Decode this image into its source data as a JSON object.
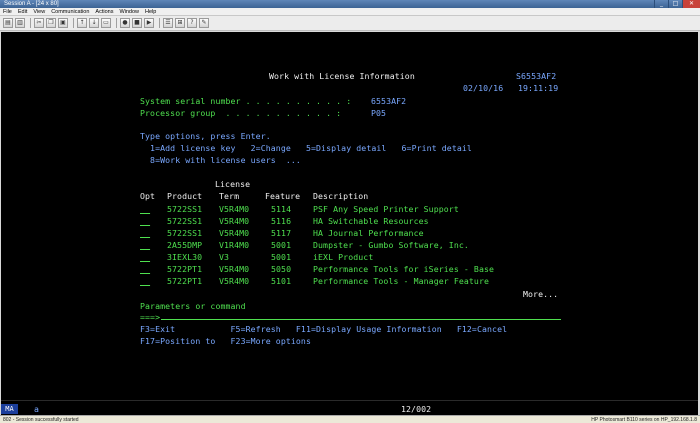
{
  "window": {
    "title": "Session A - [24 x 80]",
    "controls": [
      "_",
      "□",
      "✕"
    ]
  },
  "menu": [
    "File",
    "Edit",
    "View",
    "Communication",
    "Actions",
    "Window",
    "Help"
  ],
  "screen": {
    "heading": "Work with License Information",
    "system_id": "S6553AF2",
    "date": "02/10/16",
    "time": "19:11:19",
    "serial_label": "System serial number . . . . . . . . . . :",
    "serial_value": "6553AF2",
    "group_label": "Processor group  . . . . . . . . . . . :",
    "group_value": "P05",
    "options_title": "Type options, press Enter.",
    "options_line1": "  1=Add license key   2=Change   5=Display detail   6=Print detail",
    "options_line2": "  8=Work with license users  ...",
    "col_license": "License",
    "col_opt": "Opt",
    "col_product": "Product",
    "col_term": "Term",
    "col_feature": "Feature",
    "col_description": "Description",
    "rows": [
      {
        "product": "5722SS1",
        "term": "V5R4M0",
        "feature": "5114",
        "description": "PSF Any Speed Printer Support"
      },
      {
        "product": "5722SS1",
        "term": "V5R4M0",
        "feature": "5116",
        "description": "HA Switchable Resources"
      },
      {
        "product": "5722SS1",
        "term": "V5R4M0",
        "feature": "5117",
        "description": "HA Journal Performance"
      },
      {
        "product": "2A55DMP",
        "term": "V1R4M0",
        "feature": "5001",
        "description": "Dumpster - Gumbo Software, Inc."
      },
      {
        "product": "3IEXL30",
        "term": "V3",
        "feature": "5001",
        "description": "iEXL Product"
      },
      {
        "product": "5722PT1",
        "term": "V5R4M0",
        "feature": "5050",
        "description": "Performance Tools for iSeries - Base"
      },
      {
        "product": "5722PT1",
        "term": "V5R4M0",
        "feature": "5101",
        "description": "Performance Tools - Manager Feature"
      }
    ],
    "more": "More...",
    "params_label": "Parameters or command",
    "prompt": "===>",
    "fkeys_line1": "F3=Exit           F5=Refresh   F11=Display Usage Information   F12=Cancel",
    "fkeys_line2": "F17=Position to   F23=More options"
  },
  "oia": {
    "mode": "MA",
    "indicator": "a",
    "cursor": "12/002"
  },
  "statusbar": {
    "left": "802 - Session successfully started",
    "right": "HP Photosmart B110 series on HP_192.168.1.8"
  }
}
